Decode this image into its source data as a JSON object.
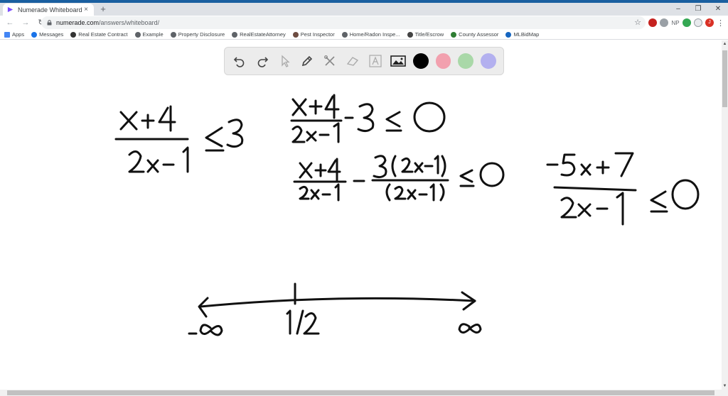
{
  "browser": {
    "tab_title": "Numerade Whiteboard",
    "tab_close": "×",
    "new_tab": "+",
    "window_controls": [
      "–",
      "❐",
      "✕"
    ],
    "url_host": "numerade.com",
    "url_path": "/answers/whiteboard/",
    "extension_np": "NP",
    "profile_initial": "J",
    "bookmarks": [
      {
        "label": "Apps",
        "icon": "apps-grid-icon"
      },
      {
        "label": "Messages",
        "icon": "messages-icon"
      },
      {
        "label": "Real Estate Contract",
        "icon": "document-icon"
      },
      {
        "label": "Example",
        "icon": "globe-icon"
      },
      {
        "label": "Property Disclosure",
        "icon": "globe-icon"
      },
      {
        "label": "RealEstateAttorney",
        "icon": "globe-icon"
      },
      {
        "label": "Pest Inspector",
        "icon": "pest-icon"
      },
      {
        "label": "Home/Radon Inspe...",
        "icon": "globe-icon"
      },
      {
        "label": "Title/Escrow",
        "icon": "title-icon"
      },
      {
        "label": "County Assessor",
        "icon": "county-icon"
      },
      {
        "label": "MLBidMap",
        "icon": "map-icon"
      }
    ]
  },
  "palette": {
    "tools": [
      "undo-icon",
      "redo-icon",
      "pointer-icon",
      "pen-icon",
      "tools-icon",
      "eraser-icon",
      "text-icon",
      "image-icon"
    ],
    "colors": [
      "#000000",
      "#f2a0ae",
      "#a9d8a8",
      "#b3b0ef"
    ]
  },
  "colors": {
    "tab_strip": "#dee1e6",
    "accent": "#1a5fa0",
    "ink": "#111111"
  }
}
